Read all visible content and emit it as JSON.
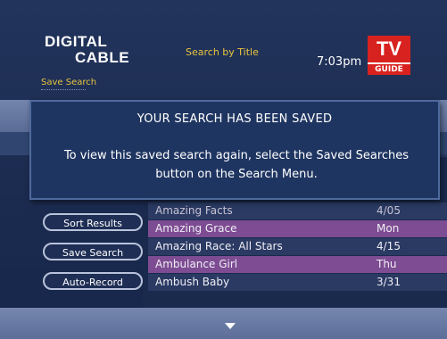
{
  "header": {
    "logo_line1": "DIGITAL",
    "logo_line2": "CABLE",
    "title": "Search by Title",
    "clock": "7:03pm",
    "tvguide_top": "TV",
    "tvguide_bottom": "GUIDE"
  },
  "subtitle": "Save Search",
  "dialog": {
    "title": "YOUR SEARCH HAS BEEN SAVED",
    "message": "To view this saved search again, select the Saved Searches button on the Search Menu."
  },
  "buttons": {
    "sort": "Sort Results",
    "save": "Save Search",
    "auto": "Auto-Record"
  },
  "results": [
    {
      "title": "Amazing Facts",
      "date": "4/05"
    },
    {
      "title": "Amazing Grace",
      "date": "Mon"
    },
    {
      "title": "Amazing Race: All Stars",
      "date": "4/15"
    },
    {
      "title": "Ambulance Girl",
      "date": "Thu"
    },
    {
      "title": "Ambush Baby",
      "date": "3/31"
    }
  ],
  "colors": {
    "accent_yellow": "#e8c33d",
    "row_purple": "#7d4c92",
    "dialog_bg": "#1f3561",
    "brand_red": "#d8221f"
  },
  "icons": {
    "down_arrow": "chevron-down-icon"
  }
}
